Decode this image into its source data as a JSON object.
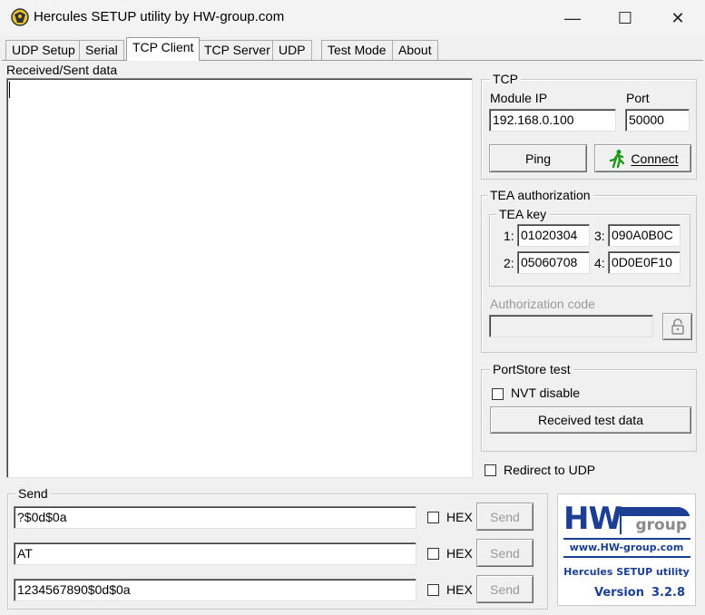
{
  "window": {
    "title": "Hercules SETUP utility by HW-group.com",
    "minimize_glyph": "—",
    "maximize_glyph": "☐",
    "close_glyph": "✕"
  },
  "tabs": [
    {
      "label": "UDP Setup",
      "active": false
    },
    {
      "label": "Serial",
      "active": false
    },
    {
      "label": "TCP Client",
      "active": true
    },
    {
      "label": "TCP Server",
      "active": false
    },
    {
      "label": "UDP",
      "active": false
    },
    {
      "label": "Test Mode",
      "active": false
    },
    {
      "label": "About",
      "active": false
    }
  ],
  "received": {
    "label": "Received/Sent data",
    "value": ""
  },
  "tcp": {
    "group_title": "TCP",
    "module_ip_label": "Module IP",
    "module_ip_value": "192.168.0.100",
    "port_label": "Port",
    "port_value": "50000",
    "ping_label": "Ping",
    "connect_label": "Connect",
    "connect_icon": "running-man-icon"
  },
  "tea": {
    "group_title": "TEA authorization",
    "key_group_title": "TEA key",
    "keys": [
      {
        "label": "1:",
        "value": "01020304"
      },
      {
        "label": "2:",
        "value": "05060708"
      },
      {
        "label": "3:",
        "value": "090A0B0C"
      },
      {
        "label": "4:",
        "value": "0D0E0F10"
      }
    ],
    "auth_code_label": "Authorization code",
    "auth_code_value": "",
    "lock_icon": "lock-icon"
  },
  "portstore": {
    "group_title": "PortStore test",
    "nvt_label": "NVT disable",
    "nvt_checked": false,
    "received_test_label": "Received test data"
  },
  "redirect": {
    "label": "Redirect to UDP",
    "checked": false
  },
  "send": {
    "group_title": "Send",
    "rows": [
      {
        "value": "?$0d$0a",
        "hex_label": "HEX",
        "hex_checked": false,
        "send_label": "Send"
      },
      {
        "value": "AT",
        "hex_label": "HEX",
        "hex_checked": false,
        "send_label": "Send"
      },
      {
        "value": "1234567890$0d$0a",
        "hex_label": "HEX",
        "hex_checked": false,
        "send_label": "Send"
      }
    ]
  },
  "logo": {
    "brand_hw": "HW",
    "brand_group": "group",
    "url": "www.HW-group.com",
    "product": "Hercules SETUP utility",
    "version_label": "Version",
    "version_value": "3.2.8",
    "colors": {
      "blue": "#1c3f94",
      "gray": "#8a8a8a"
    }
  }
}
